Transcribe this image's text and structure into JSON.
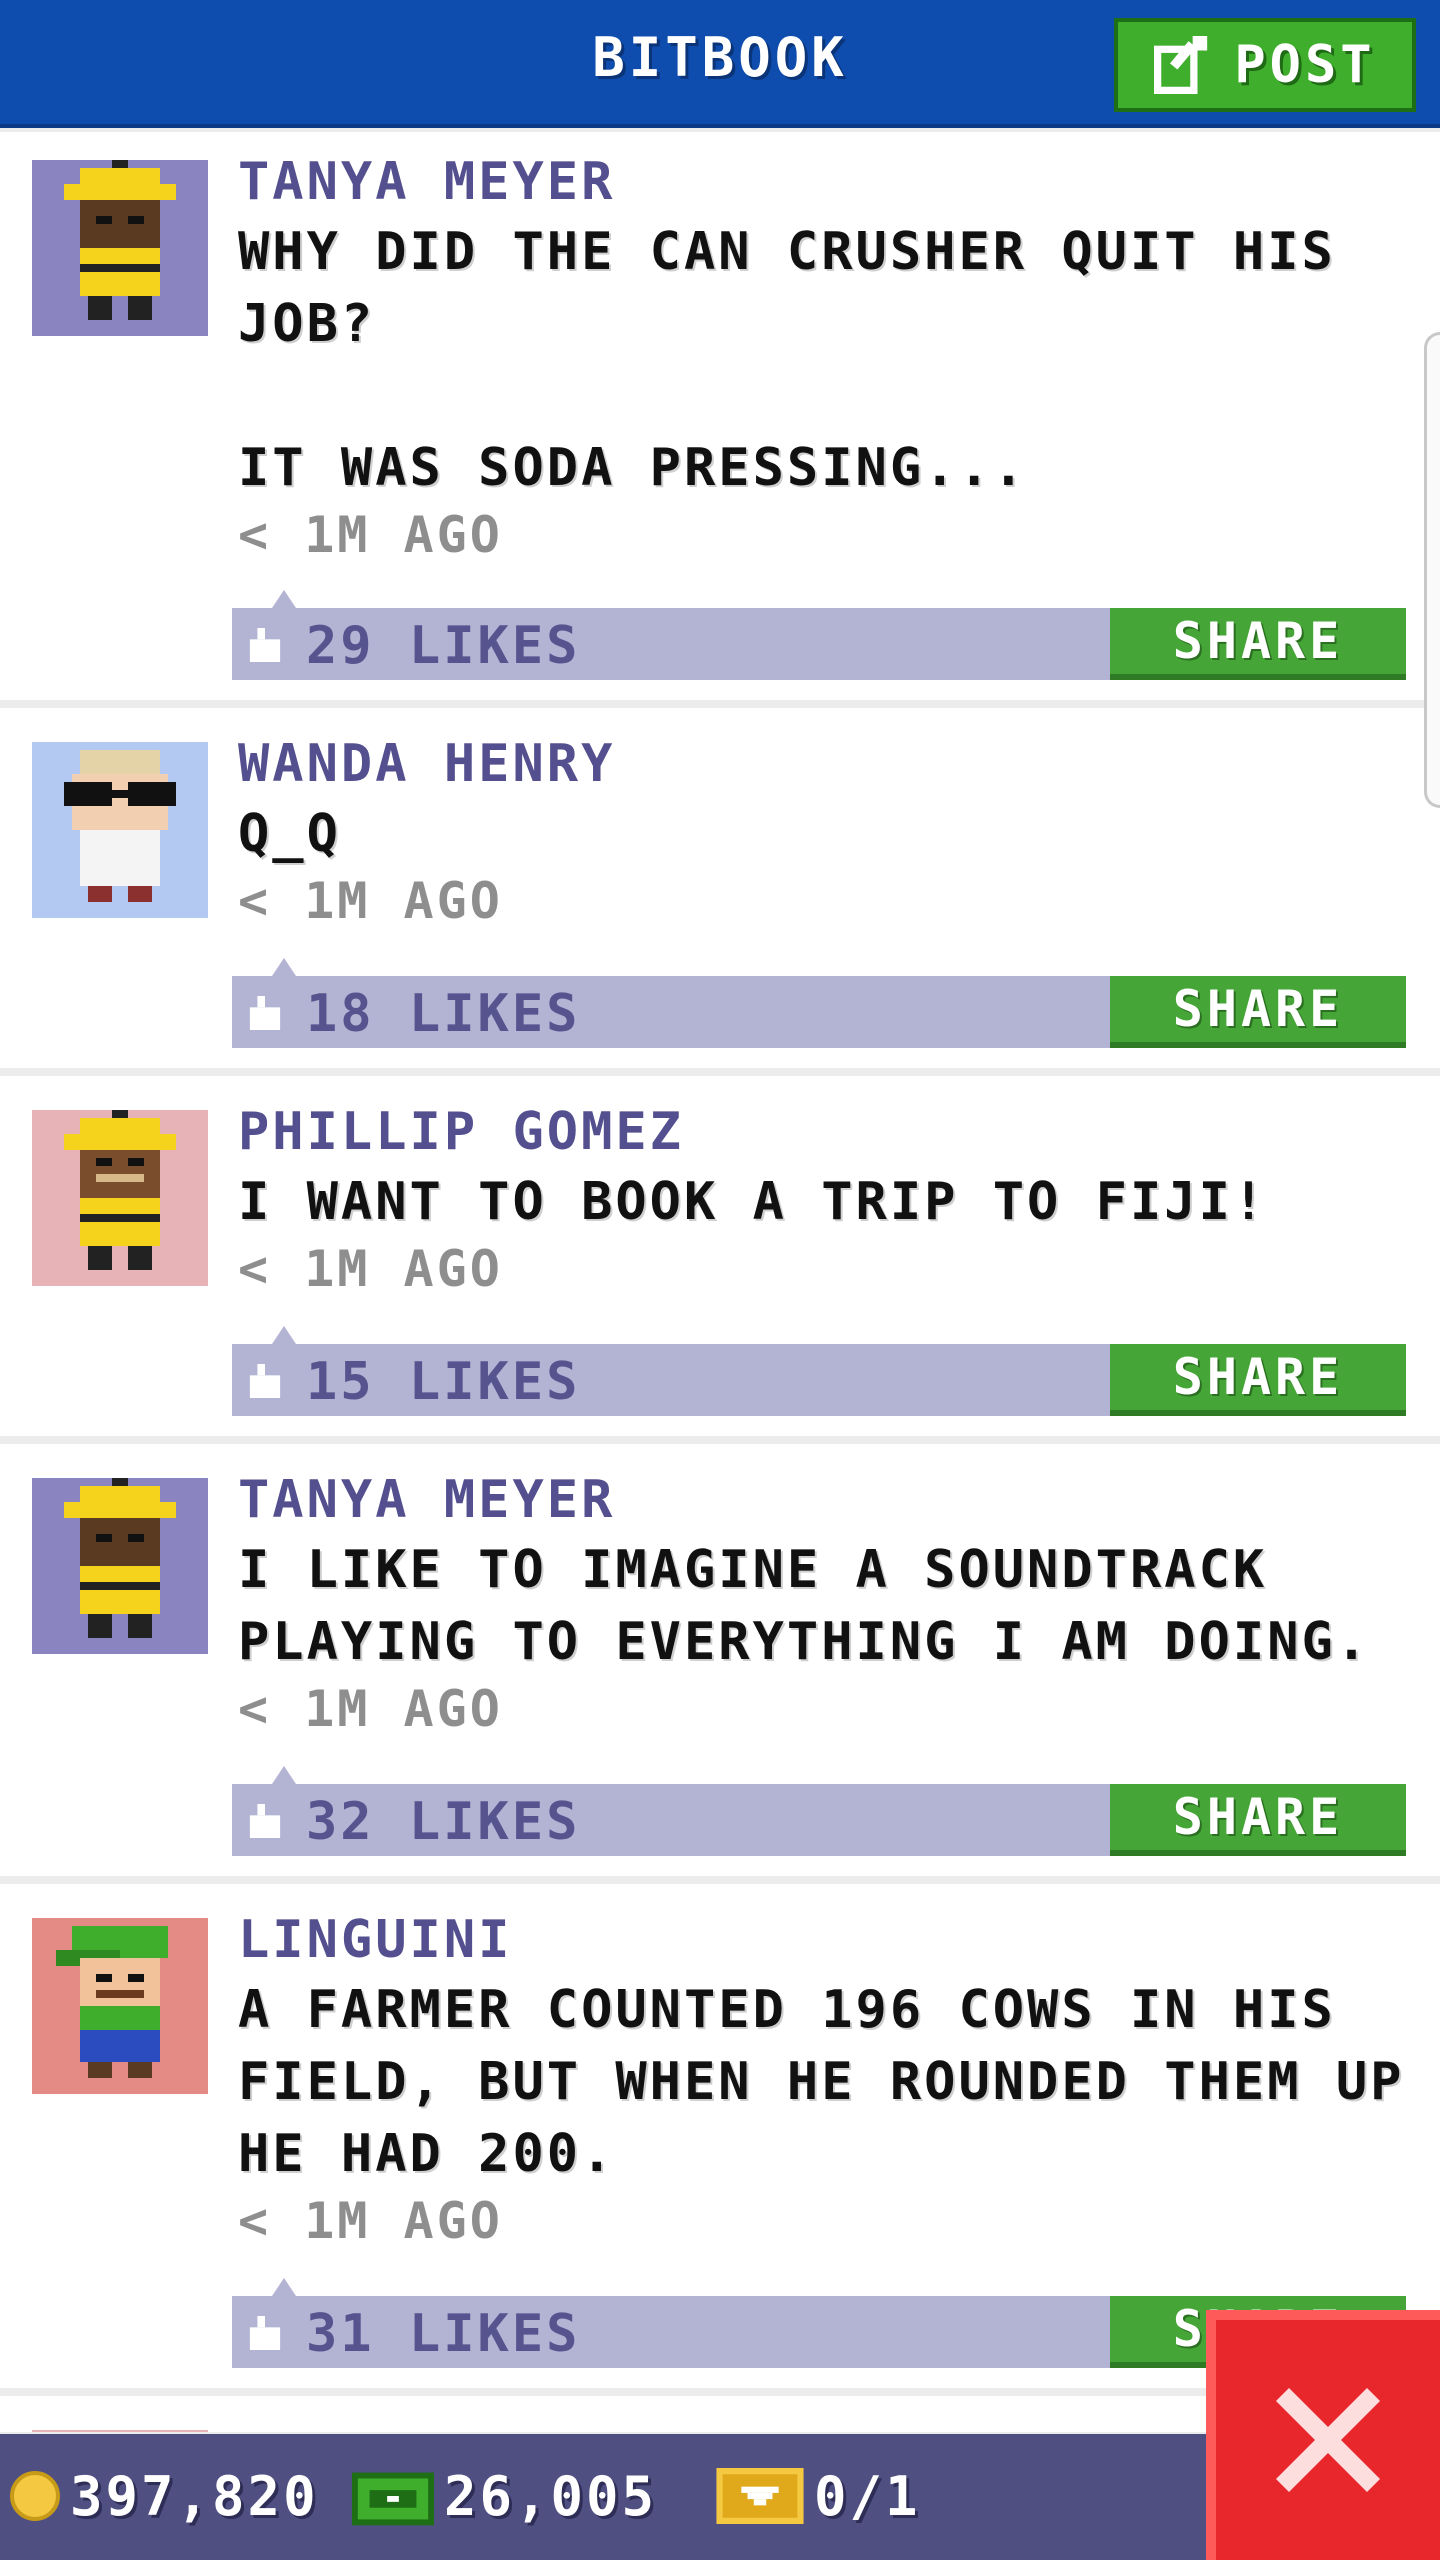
{
  "header": {
    "title": "BITBOOK",
    "post_label": "POST"
  },
  "posts": [
    {
      "author": "TANYA MEYER",
      "text": "WHY DID THE CAN CRUSHER QUIT HIS JOB?\n\nIT WAS SODA PRESSING...",
      "time": "< 1M AGO",
      "likes": "29 LIKES",
      "share": "SHARE",
      "avatar": "bitizen-hardhat-icon",
      "avatar_bg": "#8a84c1"
    },
    {
      "author": "WANDA HENRY",
      "text": "Q_Q",
      "time": "< 1M AGO",
      "likes": "18 LIKES",
      "share": "SHARE",
      "avatar": "bitizen-sunglasses-icon",
      "avatar_bg": "#b4c9f1"
    },
    {
      "author": "PHILLIP GOMEZ",
      "text": "I WANT TO BOOK A TRIP TO FIJI!",
      "time": "< 1M AGO",
      "likes": "15 LIKES",
      "share": "SHARE",
      "avatar": "bitizen-hardhat-mustache-icon",
      "avatar_bg": "#e7b3b6"
    },
    {
      "author": "TANYA MEYER",
      "text": "I LIKE TO IMAGINE A SOUNDTRACK PLAYING TO EVERYTHING I AM DOING.",
      "time": "< 1M AGO",
      "likes": "32 LIKES",
      "share": "SHARE",
      "avatar": "bitizen-hardhat-icon",
      "avatar_bg": "#8a84c1"
    },
    {
      "author": "LINGUINI",
      "text": "A FARMER COUNTED 196 COWS IN HIS FIELD, BUT WHEN HE ROUNDED THEM UP HE HAD 200.",
      "time": "< 1M AGO",
      "likes": "31 LIKES",
      "share": "SHARE",
      "avatar": "bitizen-green-cap-icon",
      "avatar_bg": "#e48b86"
    }
  ],
  "footer": {
    "coins": "397,820",
    "bux": "26,005",
    "tickets": "0/1"
  },
  "colors": {
    "header": "#0e4dad",
    "accent_green": "#45a637",
    "like_bar": "#b3b3d4",
    "name": "#54508f",
    "footer": "#4f4f82",
    "close": "#e8272d"
  }
}
